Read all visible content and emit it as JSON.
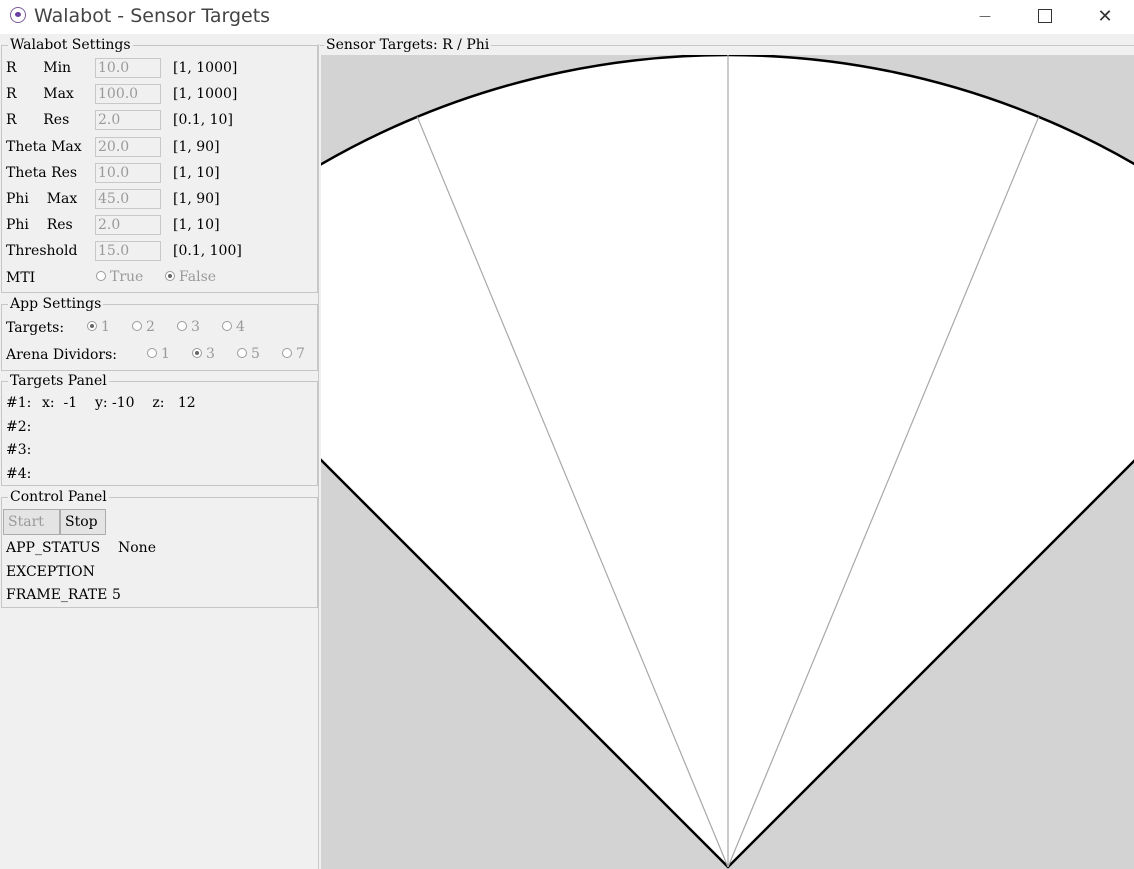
{
  "window": {
    "title": "Walabot - Sensor Targets",
    "minimize_glyph": "—",
    "close_glyph": "✕"
  },
  "walabot_settings": {
    "label": "Walabot Settings",
    "rows": [
      {
        "label": "R      Min",
        "value": "10.0",
        "range": "[1, 1000]"
      },
      {
        "label": "R      Max",
        "value": "100.0",
        "range": "[1, 1000]"
      },
      {
        "label": "R      Res",
        "value": "2.0",
        "range": "[0.1, 10]"
      },
      {
        "label": "Theta Max",
        "value": "20.0",
        "range": "[1, 90]"
      },
      {
        "label": "Theta Res",
        "value": "10.0",
        "range": "[1, 10]"
      },
      {
        "label": "Phi    Max",
        "value": "45.0",
        "range": "[1, 90]"
      },
      {
        "label": "Phi    Res",
        "value": "2.0",
        "range": "[1, 10]"
      },
      {
        "label": "Threshold",
        "value": "15.0",
        "range": "[0.1, 100]"
      }
    ],
    "mti": {
      "label": "MTI",
      "options": [
        "True",
        "False"
      ],
      "selected": "False"
    }
  },
  "app_settings": {
    "label": "App Settings",
    "targets": {
      "label": "Targets:",
      "options": [
        "1",
        "2",
        "3",
        "4"
      ],
      "selected": "1"
    },
    "arena": {
      "label": "Arena Dividors:",
      "options": [
        "1",
        "3",
        "5",
        "7"
      ],
      "selected": "3"
    }
  },
  "targets_panel": {
    "label": "Targets Panel",
    "rows": [
      {
        "id": "#1:",
        "text": "x:  -1    y: -10    z:   12"
      },
      {
        "id": "#2:",
        "text": ""
      },
      {
        "id": "#3:",
        "text": ""
      },
      {
        "id": "#4:",
        "text": ""
      }
    ]
  },
  "control_panel": {
    "label": "Control Panel",
    "start_label": "Start",
    "stop_label": "Stop",
    "status": [
      {
        "key": "APP_STATUS",
        "value": "None"
      },
      {
        "key": "EXCEPTION",
        "value": ""
      },
      {
        "key": "FRAME_RATE",
        "value": "5"
      }
    ]
  },
  "sensor_canvas": {
    "label": "Sensor Targets: R / Phi",
    "phi_max_deg": 45,
    "r_max": 100,
    "arena_dividors": 3,
    "target_color": "#0000ff",
    "targets": [
      {
        "x": -1,
        "y": -10,
        "z": 12
      }
    ]
  }
}
